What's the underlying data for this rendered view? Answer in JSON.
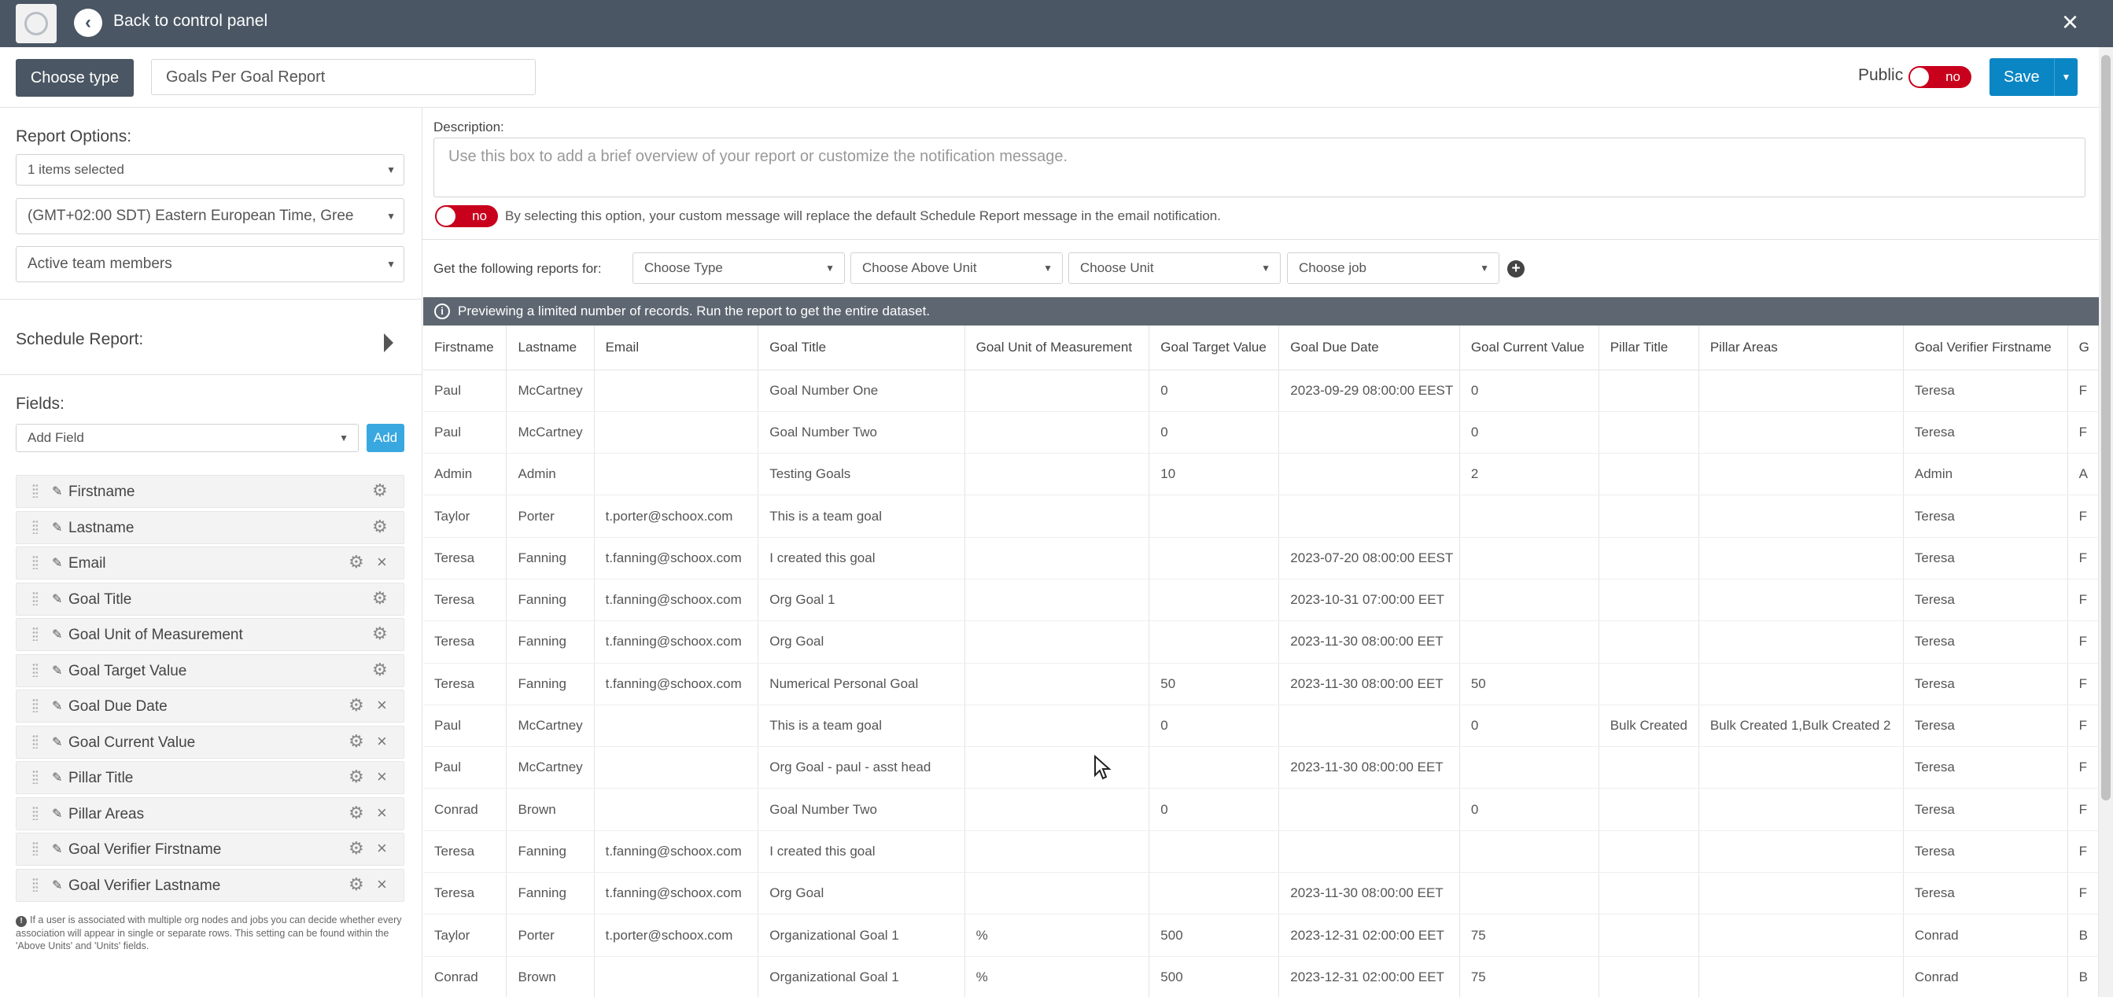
{
  "topbar": {
    "back_label": "Back to control panel",
    "close_icon": "×"
  },
  "header": {
    "choose_type_label": "Choose type",
    "report_name": "Goals Per Goal Report",
    "public_label": "Public",
    "public_toggle": "no",
    "save_label": "Save"
  },
  "left": {
    "report_options_title": "Report Options:",
    "items_selected": "1 items selected",
    "timezone": "(GMT+02:00 SDT) Eastern European Time, Gree",
    "team_members": "Active team members",
    "schedule_title": "Schedule Report:",
    "fields_title": "Fields:",
    "add_field_placeholder": "Add Field",
    "add_label": "Add",
    "fields": [
      {
        "name": "Firstname",
        "removable": false
      },
      {
        "name": "Lastname",
        "removable": false
      },
      {
        "name": "Email",
        "removable": true
      },
      {
        "name": "Goal Title",
        "removable": false
      },
      {
        "name": "Goal Unit of Measurement",
        "removable": false
      },
      {
        "name": "Goal Target Value",
        "removable": false
      },
      {
        "name": "Goal Due Date",
        "removable": true
      },
      {
        "name": "Goal Current Value",
        "removable": true
      },
      {
        "name": "Pillar Title",
        "removable": true
      },
      {
        "name": "Pillar Areas",
        "removable": true
      },
      {
        "name": "Goal Verifier Firstname",
        "removable": true
      },
      {
        "name": "Goal Verifier Lastname",
        "removable": true
      }
    ],
    "note": "If a user is associated with multiple org nodes and jobs you can decide whether every association will appear in single or separate rows. This setting can be found within the 'Above Units' and 'Units' fields."
  },
  "right": {
    "description_label": "Description:",
    "description_placeholder": "Use this box to add a brief overview of your report or customize the notification message.",
    "custom_toggle": "no",
    "custom_toggle_text": "By selecting this option, your custom message will replace the default Schedule Report message in the email notification.",
    "get_reports_label": "Get the following reports for:",
    "filters": [
      "Choose Type",
      "Choose Above Unit",
      "Choose Unit",
      "Choose job"
    ],
    "banner": "Previewing a limited number of records. Run the report to get the entire dataset."
  },
  "table": {
    "columns": [
      "Firstname",
      "Lastname",
      "Email",
      "Goal Title",
      "Goal Unit of Measurement",
      "Goal Target Value",
      "Goal Due Date",
      "Goal Current Value",
      "Pillar Title",
      "Pillar Areas",
      "Goal Verifier Firstname",
      "G"
    ],
    "rows": [
      [
        "Paul",
        "McCartney",
        "",
        "Goal Number One",
        "",
        "0",
        "2023-09-29 08:00:00 EEST",
        "0",
        "",
        "",
        "Teresa",
        "F"
      ],
      [
        "Paul",
        "McCartney",
        "",
        "Goal Number Two",
        "",
        "0",
        "",
        "0",
        "",
        "",
        "Teresa",
        "F"
      ],
      [
        "Admin",
        "Admin",
        "",
        "Testing Goals",
        "",
        "10",
        "",
        "2",
        "",
        "",
        "Admin",
        "A"
      ],
      [
        "Taylor",
        "Porter",
        "t.porter@schoox.com",
        "This is a team goal",
        "",
        "",
        "",
        "",
        "",
        "",
        "Teresa",
        "F"
      ],
      [
        "Teresa",
        "Fanning",
        "t.fanning@schoox.com",
        "I created this goal",
        "",
        "",
        "2023-07-20 08:00:00 EEST",
        "",
        "",
        "",
        "Teresa",
        "F"
      ],
      [
        "Teresa",
        "Fanning",
        "t.fanning@schoox.com",
        "Org Goal 1",
        "",
        "",
        "2023-10-31 07:00:00 EET",
        "",
        "",
        "",
        "Teresa",
        "F"
      ],
      [
        "Teresa",
        "Fanning",
        "t.fanning@schoox.com",
        "Org Goal",
        "",
        "",
        "2023-11-30 08:00:00 EET",
        "",
        "",
        "",
        "Teresa",
        "F"
      ],
      [
        "Teresa",
        "Fanning",
        "t.fanning@schoox.com",
        "Numerical Personal Goal",
        "",
        "50",
        "2023-11-30 08:00:00 EET",
        "50",
        "",
        "",
        "Teresa",
        "F"
      ],
      [
        "Paul",
        "McCartney",
        "",
        "This is a team goal",
        "",
        "0",
        "",
        "0",
        "Bulk Created",
        "Bulk Created 1,Bulk Created 2",
        "Teresa",
        "F"
      ],
      [
        "Paul",
        "McCartney",
        "",
        "Org Goal - paul - asst head",
        "",
        "",
        "2023-11-30 08:00:00 EET",
        "",
        "",
        "",
        "Teresa",
        "F"
      ],
      [
        "Conrad",
        "Brown",
        "",
        "Goal Number Two",
        "",
        "0",
        "",
        "0",
        "",
        "",
        "Teresa",
        "F"
      ],
      [
        "Teresa",
        "Fanning",
        "t.fanning@schoox.com",
        "I created this goal",
        "",
        "",
        "",
        "",
        "",
        "",
        "Teresa",
        "F"
      ],
      [
        "Teresa",
        "Fanning",
        "t.fanning@schoox.com",
        "Org Goal",
        "",
        "",
        "2023-11-30 08:00:00 EET",
        "",
        "",
        "",
        "Teresa",
        "F"
      ],
      [
        "Taylor",
        "Porter",
        "t.porter@schoox.com",
        "Organizational Goal 1",
        "%",
        "500",
        "2023-12-31 02:00:00 EET",
        "75",
        "",
        "",
        "Conrad",
        "B"
      ],
      [
        "Conrad",
        "Brown",
        "",
        "Organizational Goal 1",
        "%",
        "500",
        "2023-12-31 02:00:00 EET",
        "75",
        "",
        "",
        "Conrad",
        "B"
      ]
    ]
  },
  "icons": {
    "back": "chevron-left-icon",
    "close": "close-icon",
    "caret": "caret-down-icon",
    "gear": "gear-icon",
    "pencil": "pencil-icon",
    "grip": "drag-handle-icon",
    "info": "info-icon",
    "plus": "plus-circle-icon"
  },
  "colors": {
    "topbar": "#4a5663",
    "save": "#0b86c4",
    "toggle_off": "#c8001c",
    "add": "#39a8e0",
    "banner": "#5e6771"
  }
}
